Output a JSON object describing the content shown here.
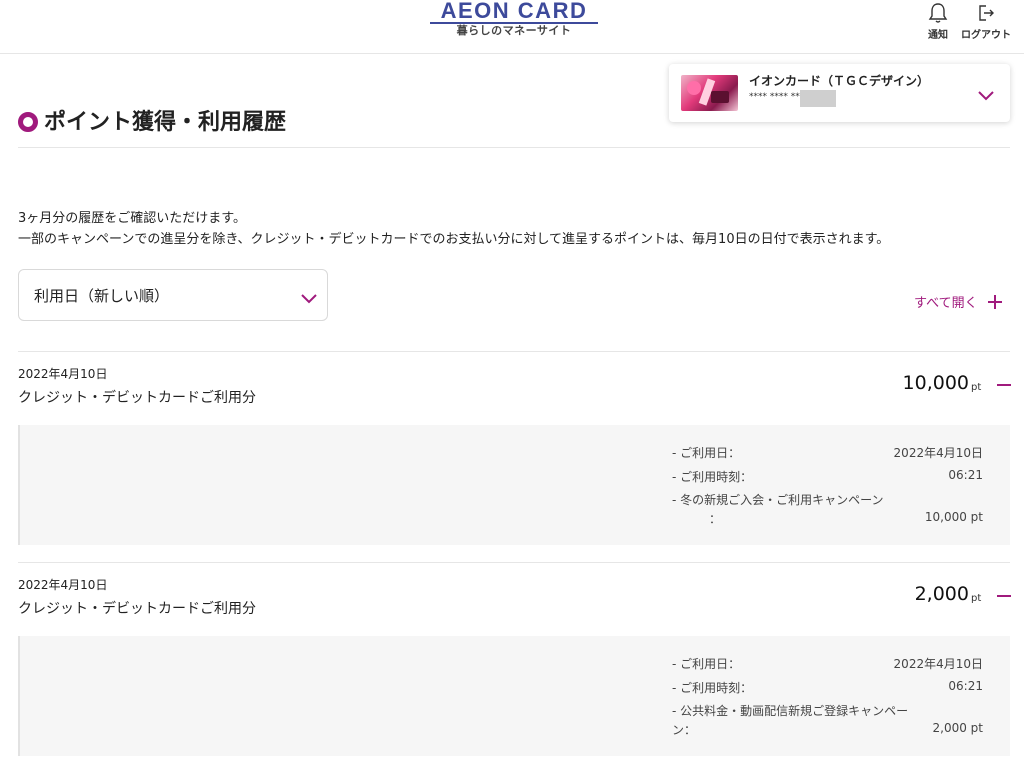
{
  "header": {
    "logo_main": "AEON CARD",
    "logo_sub": "暮らしのマネーサイト",
    "notify_label": "通知",
    "logout_label": "ログアウト"
  },
  "card": {
    "name": "イオンカード（ＴＧＣデザイン）",
    "masked_number": "**** **** ****"
  },
  "page": {
    "title": "ポイント獲得・利用履歴",
    "desc_line1": "3ヶ月分の履歴をご確認いただけます。",
    "desc_line2": "一部のキャンペーンでの進呈分を除き、クレジット・デビットカードでのお支払い分に対して進呈するポイントは、毎月10日の日付で表示されます。",
    "sort_value": "利用日（新しい順）",
    "expand_all": "すべて開く"
  },
  "colors": {
    "accent": "#a01a7d",
    "logo": "#3d4a9b"
  },
  "entries": [
    {
      "date": "2022年4月10日",
      "title": "クレジット・デビットカードご利用分",
      "points": "10,000",
      "unit": "pt",
      "details": {
        "use_date_label": "- ご利用日：",
        "use_date_value": "2022年4月10日",
        "use_time_label": "- ご利用時刻：",
        "use_time_value": "06:21",
        "campaign_label_1": "- 冬の新規ご入会・ご利用キャンペーン",
        "campaign_label_2": "：",
        "campaign_value": "10,000 pt"
      }
    },
    {
      "date": "2022年4月10日",
      "title": "クレジット・デビットカードご利用分",
      "points": "2,000",
      "unit": "pt",
      "details": {
        "use_date_label": "- ご利用日：",
        "use_date_value": "2022年4月10日",
        "use_time_label": "- ご利用時刻：",
        "use_time_value": "06:21",
        "campaign_label_1": "- 公共料金・動画配信新規ご登録キャンペー",
        "campaign_label_2": "ン：",
        "campaign_value": "2,000 pt"
      }
    }
  ]
}
